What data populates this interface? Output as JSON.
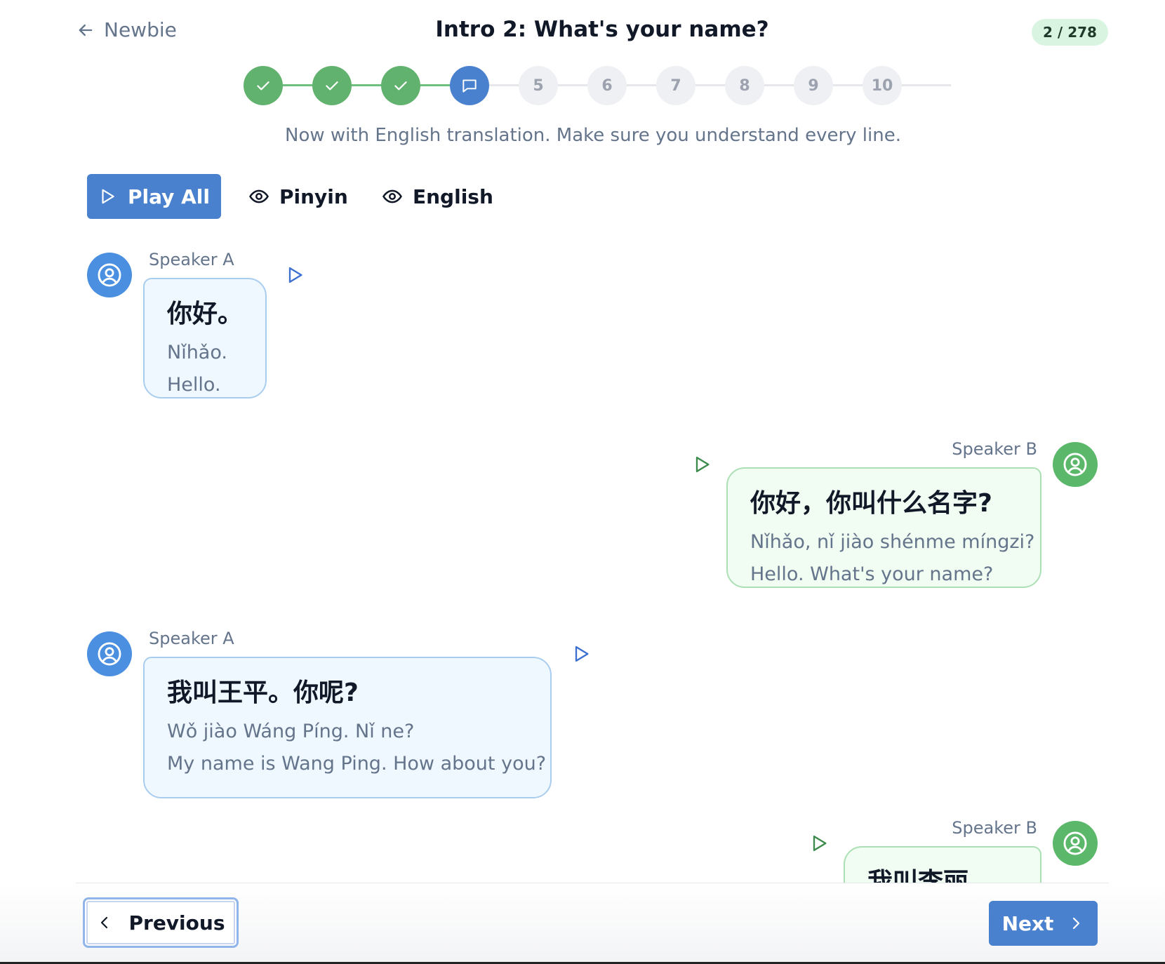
{
  "header": {
    "back_label": "Newbie",
    "title": "Intro 2: What's your name?",
    "progress_badge": "2 / 278"
  },
  "stepper": {
    "steps": [
      {
        "label": "",
        "status": "done",
        "icon": "check-icon"
      },
      {
        "label": "",
        "status": "done",
        "icon": "check-icon"
      },
      {
        "label": "",
        "status": "done",
        "icon": "check-icon"
      },
      {
        "label": "",
        "status": "current",
        "icon": "chat-bubble-icon"
      },
      {
        "label": "5",
        "status": "pending"
      },
      {
        "label": "6",
        "status": "pending"
      },
      {
        "label": "7",
        "status": "pending"
      },
      {
        "label": "8",
        "status": "pending"
      },
      {
        "label": "9",
        "status": "pending"
      },
      {
        "label": "10",
        "status": "pending"
      }
    ],
    "instruction": "Now with English translation. Make sure you understand every line."
  },
  "controls": {
    "play_all_label": "Play All",
    "pinyin_label": "Pinyin",
    "english_label": "English"
  },
  "dialogue": [
    {
      "speaker": "Speaker A",
      "chinese": "你好。",
      "pinyin": "Nǐhǎo.",
      "english": "Hello."
    },
    {
      "speaker": "Speaker B",
      "chinese": "你好，你叫什么名字?",
      "pinyin": "Nǐhǎo, nǐ jiào shénme míngzi?",
      "english": "Hello. What's your name?"
    },
    {
      "speaker": "Speaker A",
      "chinese": "我叫王平。你呢?",
      "pinyin": "Wǒ jiào Wáng Píng. Nǐ ne?",
      "english": "My name is Wang Ping. How about you?"
    },
    {
      "speaker": "Speaker B",
      "chinese": "我叫李丽。",
      "pinyin": "",
      "english": ""
    }
  ],
  "footer": {
    "previous_label": "Previous",
    "next_label": "Next"
  },
  "colors": {
    "primary": "#4a81cf",
    "done": "#62b26f",
    "speaker_a": "#4a8fe0",
    "speaker_b": "#5bb86b",
    "badge_bg": "#d9f5e2"
  }
}
